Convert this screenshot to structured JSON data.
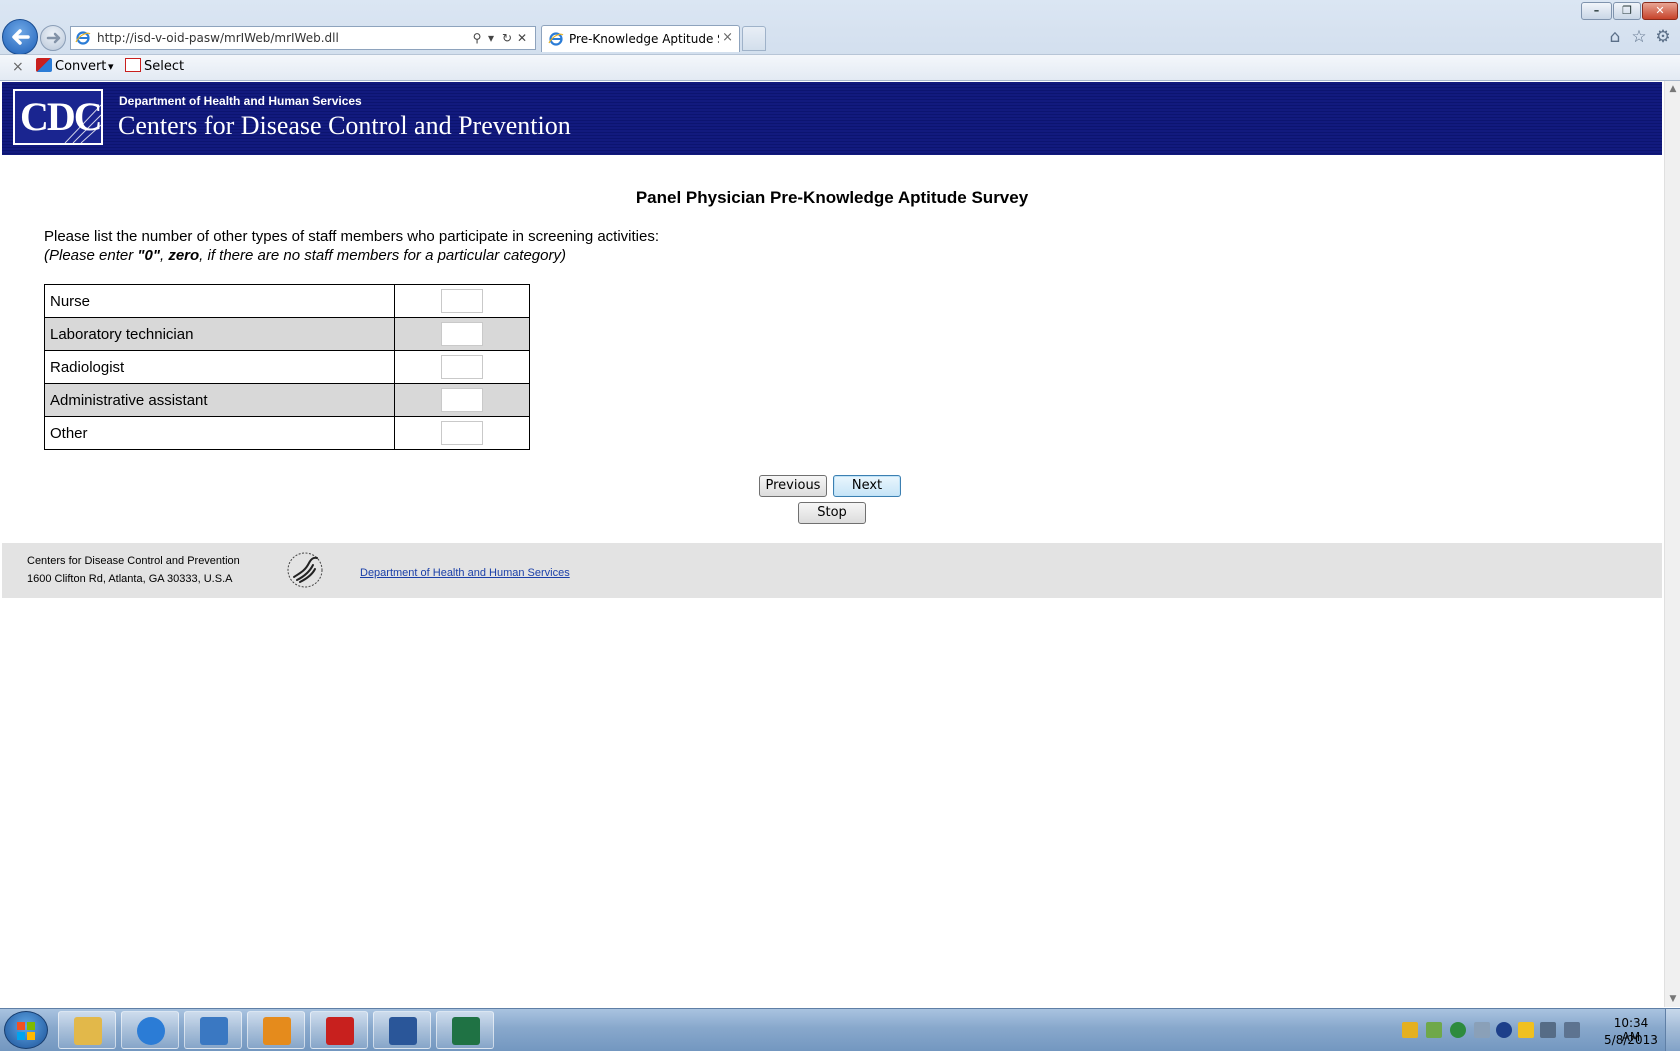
{
  "browser": {
    "url": "http://isd-v-oid-pasw/mrIWeb/mrIWeb.dll",
    "tab_title": "Pre-Knowledge Aptitude S...",
    "tab_close": "×",
    "window_buttons": {
      "minimize": "–",
      "restore": "❐",
      "close": "✕"
    },
    "address_tools": {
      "search": "⚲",
      "dropdown": "▾",
      "refresh": "↻",
      "stop": "✕"
    },
    "right_tools": {
      "home": "⌂",
      "favorites": "☆",
      "settings": "⚙"
    },
    "command_bar": {
      "close": "×",
      "convert_label": "Convert",
      "convert_arrow": "▾",
      "select_label": "Select"
    }
  },
  "header": {
    "logo_text": "CDC",
    "department": "Department of Health and Human Services",
    "agency": "Centers for Disease Control and Prevention"
  },
  "survey": {
    "title": "Panel Physician Pre-Knowledge Aptitude Survey",
    "instruction": "Please list the number of other types of staff members who participate in screening activities:",
    "note_prefix": "(Please enter ",
    "note_zero_quoted": "\"0\"",
    "note_comma": ", ",
    "note_zero_word": "zero",
    "note_suffix": ", if there are no staff members for a particular category)",
    "rows": [
      {
        "label": "Nurse",
        "value": ""
      },
      {
        "label": "Laboratory technician",
        "value": ""
      },
      {
        "label": "Radiologist",
        "value": ""
      },
      {
        "label": "Administrative assistant",
        "value": ""
      },
      {
        "label": "Other",
        "value": ""
      }
    ],
    "buttons": {
      "previous": "Previous",
      "next": "Next",
      "stop": "Stop"
    }
  },
  "footer": {
    "org": "Centers for Disease Control and Prevention",
    "address": "1600 Clifton Rd, Atlanta, GA 30333, U.S.A",
    "link": "Department of Health and Human Services"
  },
  "taskbar": {
    "apps": [
      {
        "name": "windows-explorer",
        "color": "#e2b84a"
      },
      {
        "name": "internet-explorer",
        "color": "#2b7cd6"
      },
      {
        "name": "lync",
        "color": "#3a78c2"
      },
      {
        "name": "outlook",
        "color": "#e58b1c"
      },
      {
        "name": "adobe-reader",
        "color": "#c8201e"
      },
      {
        "name": "word",
        "color": "#2a5699"
      },
      {
        "name": "excel",
        "color": "#1f7244"
      }
    ],
    "clock_time": "10:34 AM",
    "clock_date": "5/8/2013"
  },
  "colors": {
    "cdc_blue": "#121a7e",
    "row_alt": "#d8d8d8",
    "footer_bg": "#e3e3e3",
    "link": "#1a3fa8"
  }
}
